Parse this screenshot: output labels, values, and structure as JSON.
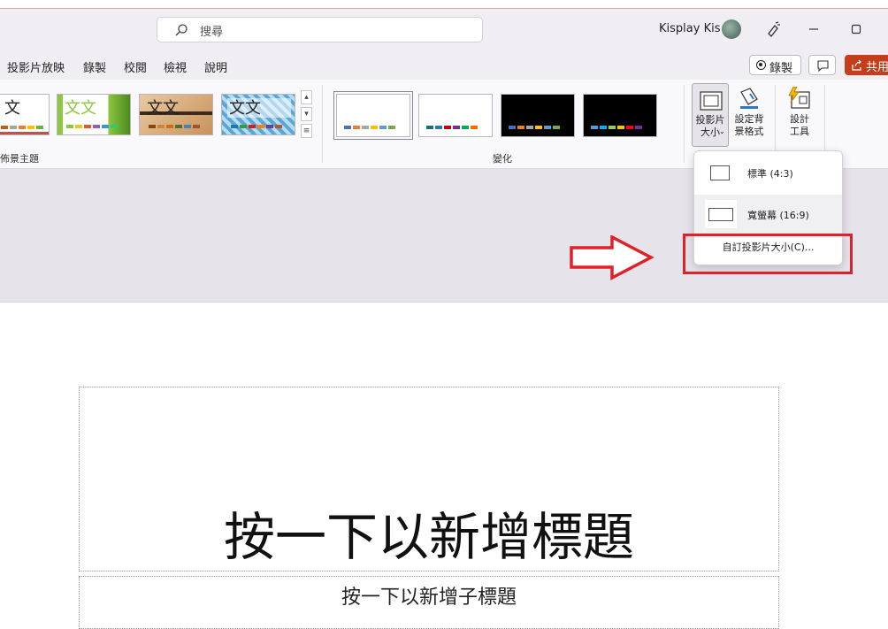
{
  "search": {
    "placeholder": "搜尋"
  },
  "user": {
    "name": "Kisplay Kis"
  },
  "menu": {
    "items": [
      "投影片放映",
      "錄製",
      "校閱",
      "檢視",
      "說明"
    ]
  },
  "actions": {
    "record_label": "錄製",
    "share_label": "共用"
  },
  "ribbon": {
    "themes_group_label": "佈景主題",
    "variants_group_label": "變化",
    "theme_thumbs": [
      "文",
      "文文",
      "文文",
      "文文"
    ],
    "slide_size_label": "投影片\n大小",
    "format_bg_label": "設定背\n景格式",
    "designer_label": "設計\n工具"
  },
  "dropdown": {
    "standard_label": "標準 (4:3)",
    "widescreen_label": "寬螢幕 (16:9)",
    "custom_label": "自訂投影片大小(C)..."
  },
  "slide": {
    "title_placeholder": "按一下以新增標題",
    "subtitle_placeholder": "按一下以新增子標題"
  },
  "colors": {
    "accent_share": "#c43e1c",
    "highlight_red": "#e0212a"
  }
}
